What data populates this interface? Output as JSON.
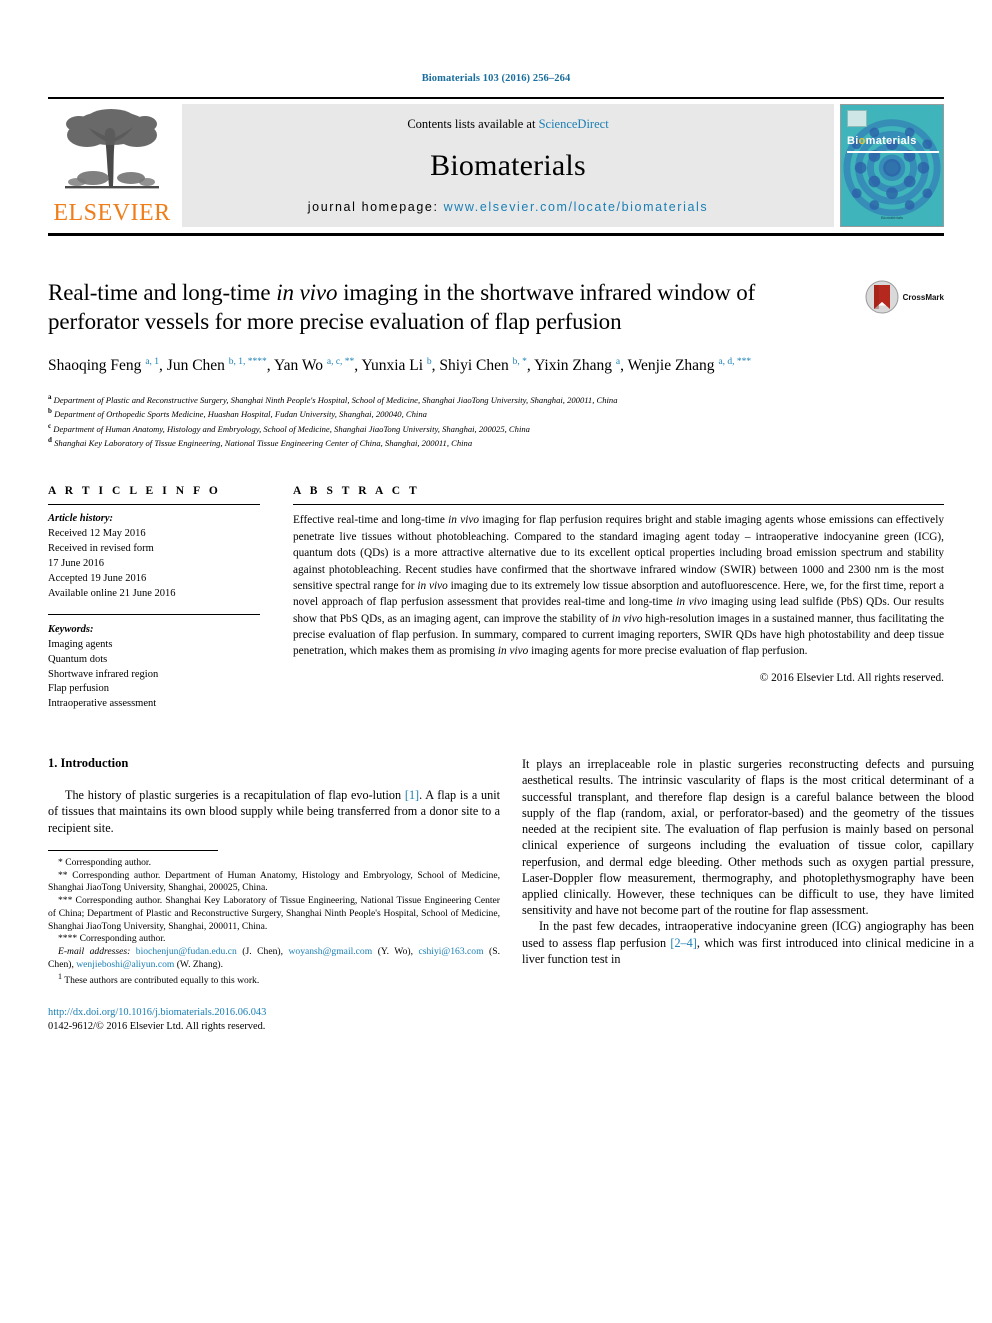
{
  "running_head": "Biomaterials 103 (2016) 256–264",
  "masthead": {
    "contents_prefix": "Contents lists available at ",
    "sciencedirect": "ScienceDirect",
    "journal_name": "Biomaterials",
    "homepage_prefix": "journal homepage: ",
    "homepage_url": "www.elsevier.com/locate/biomaterials",
    "publisher_logo_text": "ELSEVIER",
    "cover_title_b": "Bi",
    "cover_title_o": "o",
    "cover_title_rest": "materials",
    "cover_footer": "Biomaterials",
    "accent_link": "#1a7fb5",
    "publisher_orange": "#ef7d1a",
    "cover_teal": "#39b0b8"
  },
  "article": {
    "title_part1": "Real-time and long-time ",
    "title_italic": "in vivo",
    "title_part2": " imaging in the shortwave infrared window of perforator vessels for more precise evaluation of flap perfusion",
    "crossmark_label": "CrossMark",
    "authors": [
      {
        "name": "Shaoqing Feng",
        "marks": "a, 1",
        "sep": ", "
      },
      {
        "name": "Jun Chen",
        "marks": "b, 1, ****",
        "sep": ", "
      },
      {
        "name": "Yan Wo",
        "marks": "a, c, **",
        "sep": ", "
      },
      {
        "name": "Yunxia Li",
        "marks": "b",
        "sep": ", "
      },
      {
        "name": "Shiyi Chen",
        "marks": "b, *",
        "sep": ", "
      },
      {
        "name": "Yixin Zhang",
        "marks": "a",
        "sep": ", "
      },
      {
        "name": "Wenjie Zhang",
        "marks": "a, d, ***",
        "sep": ""
      }
    ],
    "affiliations": [
      {
        "mark": "a",
        "text": "Department of Plastic and Reconstructive Surgery, Shanghai Ninth People's Hospital, School of Medicine, Shanghai JiaoTong University, Shanghai, 200011, China"
      },
      {
        "mark": "b",
        "text": "Department of Orthopedic Sports Medicine, Huashan Hospital, Fudan University, Shanghai, 200040, China"
      },
      {
        "mark": "c",
        "text": "Department of Human Anatomy, Histology and Embryology, School of Medicine, Shanghai JiaoTong University, Shanghai, 200025, China"
      },
      {
        "mark": "d",
        "text": "Shanghai Key Laboratory of Tissue Engineering, National Tissue Engineering Center of China, Shanghai, 200011, China"
      }
    ]
  },
  "article_info": {
    "heading": "A R T I C L E   I N F O",
    "history_label": "Article history:",
    "history": [
      "Received 12 May 2016",
      "Received in revised form",
      "17 June 2016",
      "Accepted 19 June 2016",
      "Available online 21 June 2016"
    ],
    "keywords_label": "Keywords:",
    "keywords": [
      "Imaging agents",
      "Quantum dots",
      "Shortwave infrared region",
      "Flap perfusion",
      "Intraoperative assessment"
    ]
  },
  "abstract": {
    "heading": "A B S T R A C T",
    "p1": "Effective real-time and long-time ",
    "i1": "in vivo",
    "p2": " imaging for flap perfusion requires bright and stable imaging agents whose emissions can effectively penetrate live tissues without photobleaching. Compared to the standard imaging agent today – intraoperative indocyanine green (ICG), quantum dots (QDs) is a more attractive alternative due to its excellent optical properties including broad emission spectrum and stability against photobleaching. Recent studies have confirmed that the shortwave infrared window (SWIR) between 1000 and 2300 nm is the most sensitive spectral range for ",
    "i2": "in vivo",
    "p3": " imaging due to its extremely low tissue absorption and autofluorescence. Here, we, for the first time, report a novel approach of flap perfusion assessment that provides real-time and long-time ",
    "i3": "in vivo",
    "p4": " imaging using lead sulfide (PbS) QDs. Our results show that PbS QDs, as an imaging agent, can improve the stability of ",
    "i4": "in vivo",
    "p5": " high-resolution images in a sustained manner, thus facilitating the precise evaluation of flap perfusion. In summary, compared to current imaging reporters, SWIR QDs have high photostability and deep tissue penetration, which makes them as promising ",
    "i5": "in vivo",
    "p6": " imaging agents for more precise evaluation of flap perfusion.",
    "copyright": "© 2016 Elsevier Ltd. All rights reserved."
  },
  "main": {
    "section_number_title": "1.  Introduction",
    "left_para_1a": "The history of plastic surgeries is a recapitulation of flap evo-lution ",
    "left_ref_1": "[1]",
    "left_para_1b": ". A flap is a unit of tissues that maintains its own blood supply while being transferred from a donor site to a recipient site.",
    "right_para_1": "It plays an irreplaceable role in plastic surgeries reconstructing defects and pursuing aesthetical results. The intrinsic vascularity of flaps is the most critical determinant of a successful transplant, and therefore flap design is a careful balance between the blood supply of the flap (random, axial, or perforator-based) and the geometry of the tissues needed at the recipient site. The evaluation of flap perfusion is mainly based on personal clinical experience of surgeons including the evaluation of tissue color, capillary reperfusion, and dermal edge bleeding. Other methods such as oxygen partial pressure, Laser-Doppler flow measurement, thermography, and photoplethysmography have been applied clinically. However, these techniques can be difficult to use, they have limited sensitivity and have not become part of the routine for flap assessment.",
    "right_para_2a": "In the past few decades, intraoperative indocyanine green (ICG) angiography has been used to assess flap perfusion ",
    "right_ref_2": "[2–4]",
    "right_para_2b": ", which was first introduced into clinical medicine in a liver function test in"
  },
  "footnotes": {
    "f1": "* Corresponding author.",
    "f2": "** Corresponding author. Department of Human Anatomy, Histology and Embryology, School of Medicine, Shanghai JiaoTong University, Shanghai, 200025, China.",
    "f3": "*** Corresponding author. Shanghai Key Laboratory of Tissue Engineering, National Tissue Engineering Center of China; Department of Plastic and Reconstructive Surgery, Shanghai Ninth People's Hospital, School of Medicine, Shanghai JiaoTong University, Shanghai, 200011, China.",
    "f4": "**** Corresponding author.",
    "email_label": "E-mail addresses:",
    "emails": [
      {
        "addr": "biochenjun@fudan.edu.cn",
        "who": " (J. Chen), "
      },
      {
        "addr": "woyansh@gmail.com",
        "who": " (Y. Wo), "
      },
      {
        "addr": "cshiyi@163.com",
        "who": " (S. Chen), "
      },
      {
        "addr": "wenjieboshi@aliyun.com",
        "who": " (W. Zhang)."
      }
    ],
    "equal_contrib_mark": "1",
    "equal_contrib": " These authors are contributed equally to this work."
  },
  "doi": {
    "url": "http://dx.doi.org/10.1016/j.biomaterials.2016.06.043",
    "issn_line": "0142-9612/© 2016 Elsevier Ltd. All rights reserved."
  }
}
